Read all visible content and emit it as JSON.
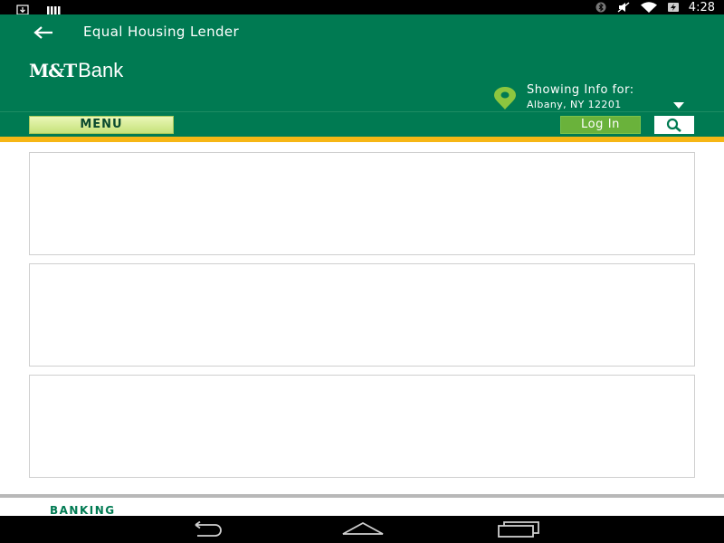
{
  "status_bar": {
    "time": "4:28",
    "left_icons": [
      "download-icon",
      "signal-bars-icon"
    ],
    "right_icons": [
      "bluetooth-icon",
      "mute-icon",
      "wifi-icon",
      "battery-charging-icon"
    ]
  },
  "header": {
    "title": "Equal Housing Lender",
    "logo": {
      "mark": "M&T",
      "name": "Bank"
    },
    "location": {
      "label": "Showing Info for:",
      "value": "Albany, NY 12201"
    }
  },
  "menu_bar": {
    "menu_label": "MENU",
    "login_label": "Log In"
  },
  "footer": {
    "section_label": "BANKING"
  },
  "colors": {
    "brand_green": "#007a52",
    "accent_yellow": "#f6b615",
    "login_green": "#6ab23b",
    "menu_button_light": "#eaf7b7"
  }
}
